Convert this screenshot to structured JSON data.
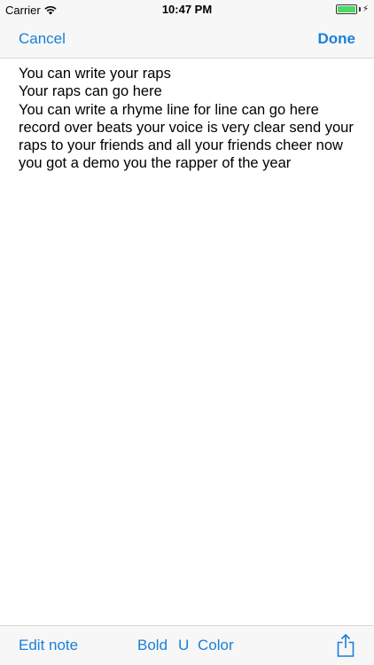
{
  "status_bar": {
    "carrier": "Carrier",
    "time": "10:47 PM",
    "battery_level": 1.0
  },
  "nav": {
    "cancel_label": "Cancel",
    "done_label": "Done"
  },
  "note": {
    "lines": [
      "You can write your raps",
      "Your raps can go here",
      "You can write a rhyme line for line can go here record over beats your voice is very clear send your raps to your friends and all your friends cheer now you got a demo you the rapper of the year"
    ]
  },
  "toolbar": {
    "edit_note_label": "Edit note",
    "bold_label": "Bold",
    "underline_label": "U",
    "color_label": "Color"
  },
  "colors": {
    "accent": "#1a7fd8",
    "bar_background": "#f7f7f7",
    "battery": "#4cd964"
  },
  "icons": {
    "status": [
      "wifi-icon",
      "battery-icon",
      "bolt-icon"
    ],
    "toolbar": [
      "share-icon"
    ]
  }
}
